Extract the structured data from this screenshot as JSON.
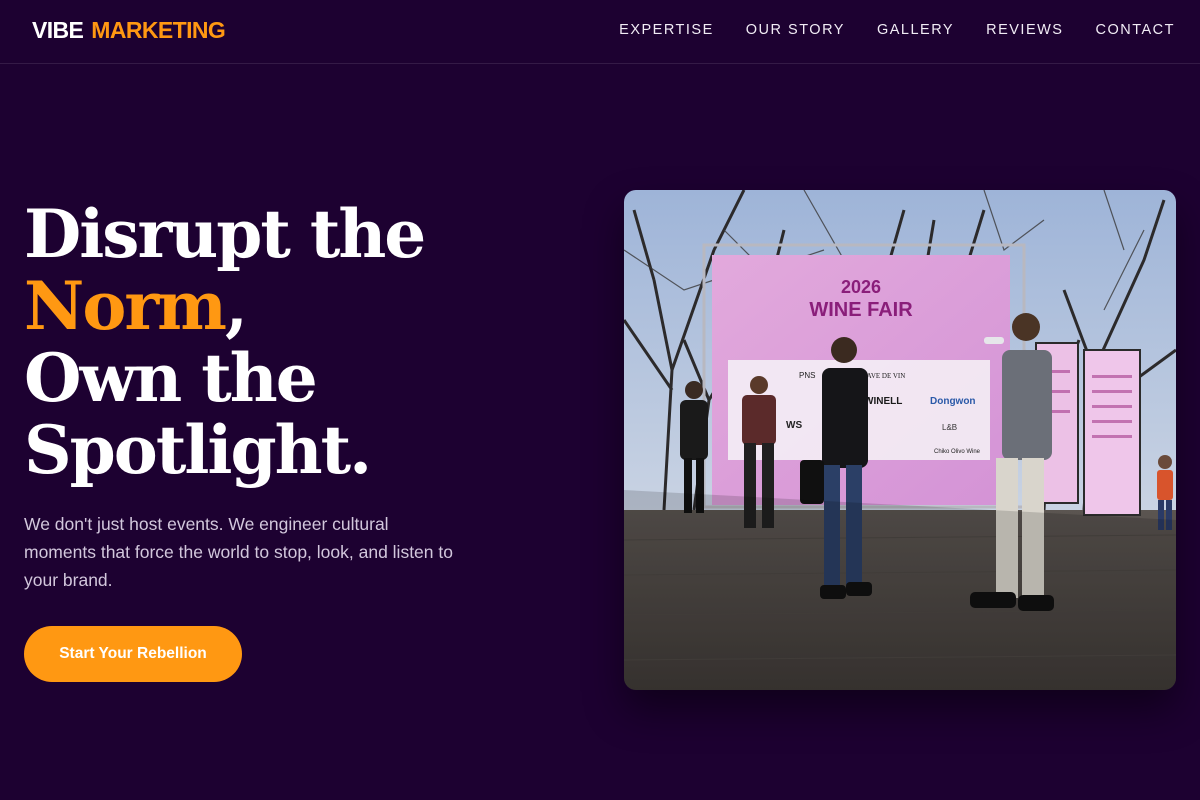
{
  "brand": {
    "word1": "VIBE",
    "word2": "MARKETING"
  },
  "nav": [
    "EXPERTISE",
    "OUR STORY",
    "GALLERY",
    "REVIEWS",
    "CONTACT"
  ],
  "hero": {
    "line1": "Disrupt the",
    "line2_accent": "Norm",
    "line2_rest": ",",
    "line3": "Own the",
    "line4": "Spotlight.",
    "subtitle": "We don't just host events. We engineer cultural moments that force the world to stop, look, and listen to your brand.",
    "cta": "Start Your Rebellion"
  },
  "photo": {
    "banner_year": "2026",
    "banner_title": "WINE FAIR",
    "sponsors": [
      "PNS",
      "CAVE DE VIN",
      "WINELL",
      "Dongwon",
      "WS",
      "Chiko Olivo Wine",
      "L&B"
    ]
  },
  "colors": {
    "background": "#1d0131",
    "accent": "#ff9812",
    "text": "#ffffff",
    "muted": "#d2c7dc"
  }
}
